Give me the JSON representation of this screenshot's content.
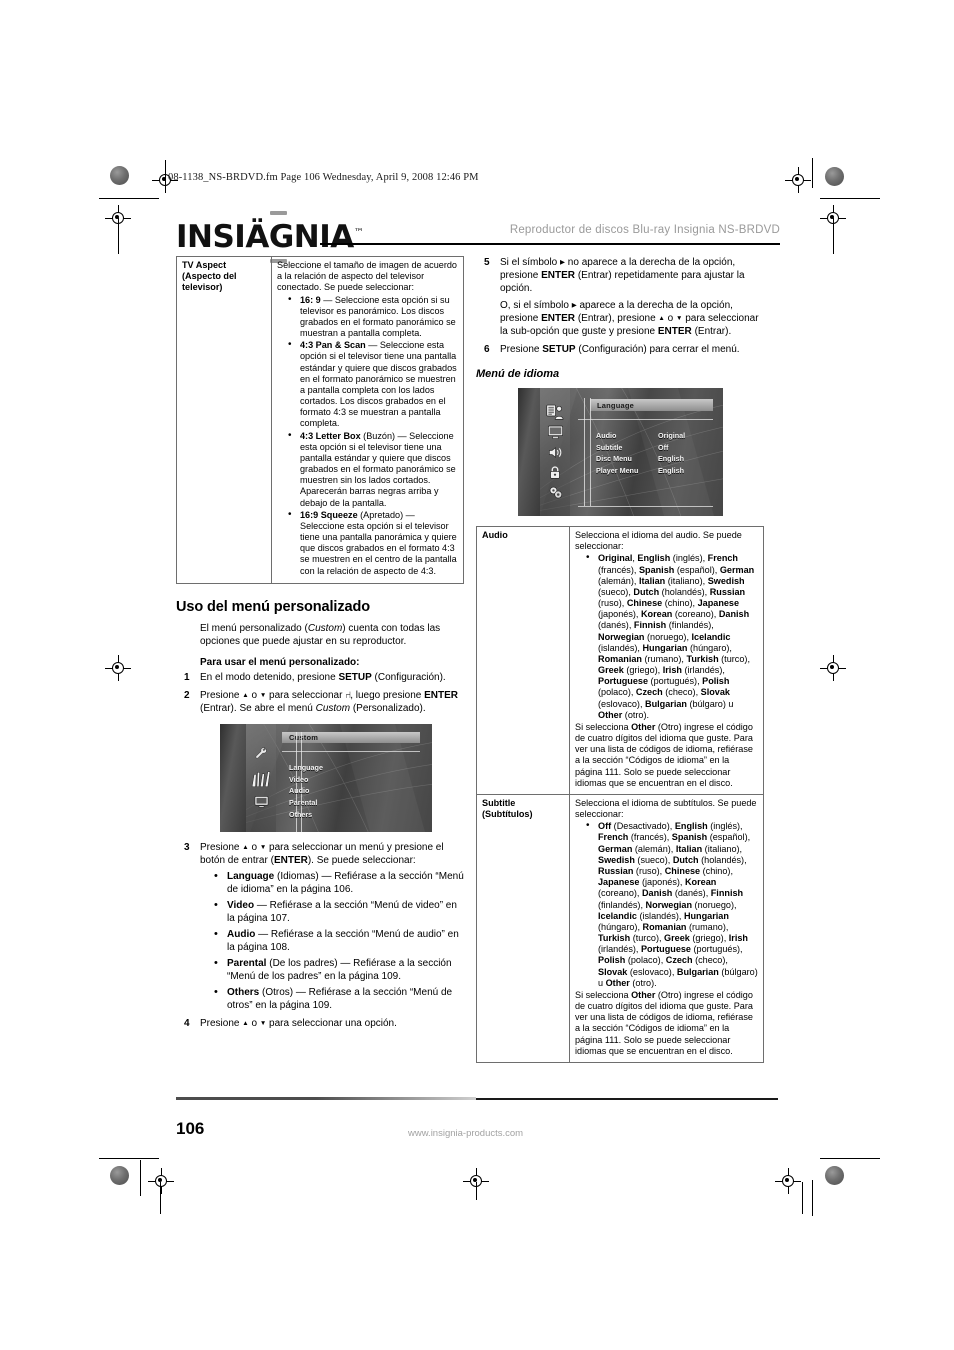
{
  "printmarks": {
    "present": true
  },
  "filestamp": "08-1138_NS-BRDVD.fm  Page 106  Wednesday, April 9, 2008  12:46 PM",
  "header": {
    "brand": "INSIGNIA",
    "brand_tm": "™",
    "running_title": "Reproductor de discos Blu-ray Insignia NS-BRDVD"
  },
  "left_column": {
    "tv_aspect_table": {
      "key": "TV Aspect (Aspecto del televisor)",
      "key_line1": "TV Aspect",
      "key_line2": "(Aspecto del",
      "key_line3": "televisor)",
      "intro": "Seleccione el tamaño de imagen de acuerdo a la relación de aspecto del televisor conectado. Se puede seleccionar:",
      "options": [
        {
          "term": "16: 9",
          "text": " — Seleccione esta opción si su televisor es panorámico. Los discos grabados en el formato panorámico se muestran a pantalla completa."
        },
        {
          "term": "4:3 Pan & Scan",
          "text": " — Seleccione esta opción si el televisor tiene una pantalla estándar y quiere que discos grabados en el formato panorámico se muestren a pantalla completa con los lados cortados. Los discos grabados en el formato 4:3 se muestran a pantalla completa."
        },
        {
          "term": "4:3 Letter Box",
          "paren": " (Buzón)",
          "text": " — Seleccione esta opción si el televisor tiene una pantalla estándar y quiere que discos grabados en el formato panorámico se muestren sin los lados cortados. Aparecerán barras negras arriba y debajo de la pantalla."
        },
        {
          "term": "16:9 Squeeze",
          "paren": " (Apretado)",
          "text": " — Seleccione esta opción si el televisor tiene una pantalla panorámica y quiere que discos grabados en el formato 4:3 se muestren en el centro de la pantalla con la relación de aspecto de 4:3."
        }
      ]
    },
    "section_heading": "Uso del menú personalizado",
    "intro_a": "El menú personalizado (",
    "intro_italic": "Custom",
    "intro_b": ") cuenta con todas las opciones que puede ajustar en su reproductor.",
    "procedure_heading": "Para usar el menú personalizado:",
    "steps": [
      {
        "num": "1",
        "html_a": "En el modo detenido, presione ",
        "bold": "SETUP",
        "html_b": " (Configuración)."
      },
      {
        "num": "2",
        "text_1": "Presione ",
        "text_2": " o ",
        "text_3": " para seleccionar ",
        "text_4": ", luego presione ",
        "bold_1": "ENTER",
        "text_5": " (Entrar). Se abre el menú ",
        "italic_1": "Custom",
        "text_6": " (Personalizado)."
      },
      {
        "num": "3",
        "text_1": "Presione ",
        "text_2": " o ",
        "text_3": " para seleccionar un menú y presione el botón de entrar (",
        "bold_1": "ENTER",
        "text_4": "). Se puede seleccionar:"
      },
      {
        "num": "4",
        "text_1": "Presione ",
        "text_2": " o ",
        "text_3": " para seleccionar una opción."
      }
    ],
    "menu_items": [
      {
        "term": "Language",
        "paren": " (Idiomas)",
        "text": " — Refiérase a la sección “Menú de idioma” en la página 106."
      },
      {
        "term": "Video",
        "paren": "",
        "text": " — Refiérase a la sección  “Menú de video” en la página 107."
      },
      {
        "term": "Audio",
        "paren": "",
        "text": " — Refiérase a la sección  “Menú de audio” en la página 108."
      },
      {
        "term": "Parental",
        "paren": " (De los padres)",
        "text": " — Refiérase a la sección “Menú de los padres” en la página 109."
      },
      {
        "term": "Others",
        "paren": " (Otros)",
        "text": " — Refiérase a la sección “Menú de otros” en la página  109."
      }
    ],
    "osd_custom": {
      "title": "Custom",
      "items": [
        "Language",
        "Video",
        "Audio",
        "Parental",
        "Others"
      ]
    }
  },
  "right_column": {
    "steps": [
      {
        "num": "5",
        "t1": "Si el símbolo ",
        "t2": " no aparece a la derecha de la opción, presione ",
        "b1": "ENTER",
        "t3": " (Entrar) repetidamente para ajustar la opción.",
        "cont_t1": "O, si el símbolo ",
        "cont_t2": " aparece a la derecha de la opción, presione ",
        "cont_b1": "ENTER",
        "cont_t3": " (Entrar), presione ",
        "cont_t4": " o ",
        "cont_t5": " para seleccionar la sub-opción que guste y presione ",
        "cont_b2": "ENTER",
        "cont_t6": " (Entrar)."
      },
      {
        "num": "6",
        "t1": "Presione ",
        "b1": "SETUP",
        "t2": " (Configuración) para cerrar el menú."
      }
    ],
    "subsection_heading": "Menú de idioma",
    "osd_language": {
      "title": "Language",
      "rows": [
        {
          "label": "Audio",
          "value": "Original"
        },
        {
          "label": "Subtitle",
          "value": "Off"
        },
        {
          "label": "Disc Menu",
          "value": "English"
        },
        {
          "label": "Player Menu",
          "value": "English"
        }
      ]
    },
    "language_table": {
      "audio": {
        "key": "Audio",
        "intro": "Selecciona el idioma del audio. Se puede seleccionar:",
        "bullet": "Original, English (inglés), French (francés), Spanish (español), German (alemán), Italian (italiano), Swedish (sueco), Dutch (holandés), Russian (ruso), Chinese (chino), Japanese (japonés), Korean (coreano), Danish (danés), Finnish (finlandés), Norwegian (noruego), Icelandic (islandés), Hungarian (húngaro), Romanian (rumano), Turkish (turco), Greek (griego), Irish (irlandés), Portuguese (portugués), Polish (polaco), Czech (checo),  Slovak (eslovaco), Bulgarian (búlgaro) u Other (otro).",
        "bullet_terms": [
          "Original",
          "English",
          "French",
          "Spanish",
          "German",
          "Italian",
          "Swedish",
          "Dutch",
          "Russian",
          "Chinese",
          "Japanese",
          "Korean",
          "Danish",
          "Finnish",
          "Norwegian",
          "Icelandic",
          "Hungarian",
          "Romanian",
          "Turkish",
          "Greek",
          "Irish",
          "Portuguese",
          "Polish",
          "Czech",
          "Slovak",
          "Bulgarian",
          "Other"
        ],
        "note": "Si selecciona Other (Otro) ingrese el código de cuatro dígitos del idioma que guste. Para ver una lista de códigos de idioma, refiérase a la sección “Códigos de idioma” en la página 111. Solo se puede seleccionar idiomas que se encuentran en el disco."
      },
      "subtitle": {
        "key_line1": "Subtitle",
        "key_line2": "(Subtítulos)",
        "intro": "Selecciona el idioma de subtítulos. Se puede seleccionar:",
        "bullet_terms": [
          "Off",
          "English",
          "French",
          "Spanish",
          "German",
          "Italian",
          "Swedish",
          "Dutch",
          "Russian",
          "Chinese",
          "Japanese",
          "Korean",
          "Danish",
          "Finnish",
          "Norwegian",
          "Icelandic",
          "Hungarian",
          "Romanian",
          "Turkish",
          "Greek",
          "Irish",
          "Portuguese",
          "Polish",
          "Czech",
          "Slovak",
          "Bulgarian",
          "Other"
        ],
        "note": "Si selecciona Other (Otro) ingrese el código de cuatro dígitos del idioma que guste. Para ver una lista de códigos de idioma, refiérase a la sección “Códigos de idioma” en la página 111. Solo se puede seleccionar idiomas que se encuentran en el disco."
      }
    }
  },
  "footer": {
    "page_number": "106",
    "url": "www.insignia-products.com"
  },
  "i18n_parens": {
    "Original": "",
    "English": "(inglés)",
    "French": "(francés)",
    "Spanish": "(español)",
    "German": "(alemán)",
    "Italian": "(italiano)",
    "Swedish": "(sueco)",
    "Dutch": "(holandés)",
    "Russian": "(ruso)",
    "Chinese": "(chino)",
    "Japanese": "(japonés)",
    "Korean": "(coreano)",
    "Danish": "(danés)",
    "Finnish": "(finlandés)",
    "Norwegian": "(noruego)",
    "Icelandic": "(islandés)",
    "Hungarian": "(húngaro)",
    "Romanian": "(rumano)",
    "Turkish": "(turco)",
    "Greek": "(griego)",
    "Irish": "(irlandés)",
    "Portuguese": "(portugués)",
    "Polish": "(polaco)",
    "Czech": "(checo)",
    "Slovak": "(eslovaco)",
    "Bulgarian": "(búlgaro)",
    "Other": "(otro)",
    "Off": "(Desactivado)"
  }
}
